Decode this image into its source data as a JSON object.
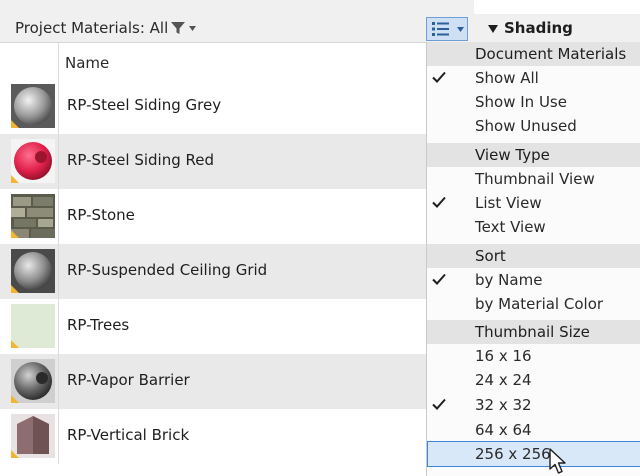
{
  "toolbar": {
    "filter_label": "Project Materials: All",
    "filter_icon": "funnel-icon",
    "view_icon": "list-view-icon"
  },
  "columns": {
    "name": "Name"
  },
  "materials": [
    {
      "name": "RP-Steel Siding Grey",
      "thumbnail": "grey-sphere"
    },
    {
      "name": "RP-Steel Siding Red",
      "thumbnail": "red-sphere"
    },
    {
      "name": "RP-Stone",
      "thumbnail": "stone-texture"
    },
    {
      "name": "RP-Suspended Ceiling Grid",
      "thumbnail": "grey-sphere"
    },
    {
      "name": "RP-Trees",
      "thumbnail": "pale-green-swatch"
    },
    {
      "name": "RP-Vapor Barrier",
      "thumbnail": "dark-sphere"
    },
    {
      "name": "RP-Vertical Brick",
      "thumbnail": "brick-texture"
    }
  ],
  "shading": {
    "title": "Shading"
  },
  "menu": {
    "sections": [
      {
        "title": "Document Materials",
        "items": [
          {
            "label": "Show All",
            "checked": true
          },
          {
            "label": "Show In Use",
            "checked": false
          },
          {
            "label": "Show Unused",
            "checked": false
          }
        ]
      },
      {
        "title": "View Type",
        "items": [
          {
            "label": "Thumbnail View",
            "checked": false
          },
          {
            "label": "List View",
            "checked": true
          },
          {
            "label": "Text View",
            "checked": false
          }
        ]
      },
      {
        "title": "Sort",
        "items": [
          {
            "label": "by Name",
            "checked": true
          },
          {
            "label": "by Material Color",
            "checked": false
          }
        ]
      },
      {
        "title": "Thumbnail Size",
        "items": [
          {
            "label": "16 x 16",
            "checked": false
          },
          {
            "label": "24 x 24",
            "checked": false
          },
          {
            "label": "32 x 32",
            "checked": true
          },
          {
            "label": "64 x 64",
            "checked": false
          },
          {
            "label": "256 x 256",
            "checked": false,
            "hovered": true
          }
        ]
      }
    ]
  },
  "colors": {
    "accent": "#3f86d8",
    "row_alt": "#e9e9e9",
    "section_bg": "#e3e3e3",
    "hover_bg": "#d9e8f8"
  }
}
